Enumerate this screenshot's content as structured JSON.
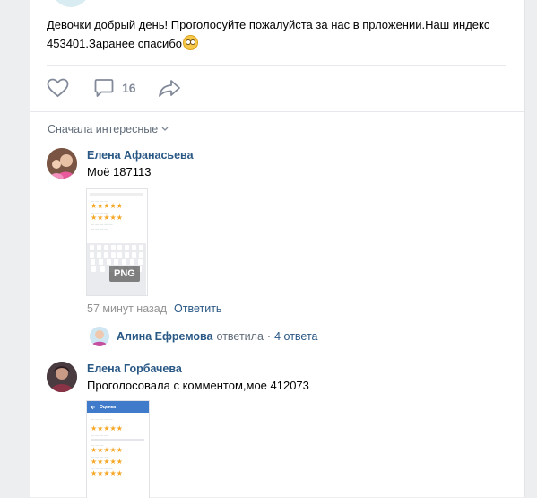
{
  "post": {
    "text_line1": "Девочки добрый день! Проголосуйте пожалуйста за нас в прложении.Наш индекс",
    "text_line2": "453401.Заранее спасибо",
    "emoji": "flushed-face-emoji"
  },
  "actions": {
    "comments_count": "16"
  },
  "sort": {
    "label": "Сначала интересные"
  },
  "comments": [
    {
      "author": "Елена Афанасьева",
      "text": "Моё 187113",
      "attachment_badge": "PNG",
      "time": "57 минут назад",
      "reply_label": "Ответить"
    },
    {
      "author": "Елена Горбачева",
      "text": "Проголосовала с комментом,мое 412073",
      "attachment_title": "Оценка"
    }
  ],
  "thread": {
    "author": "Алина Ефремова",
    "action": "ответила",
    "separator": "·",
    "replies": "4 ответа"
  },
  "colors": {
    "link": "#2a5885",
    "muted": "#828a99",
    "background": "#edeef0",
    "star": "#f5a623"
  }
}
